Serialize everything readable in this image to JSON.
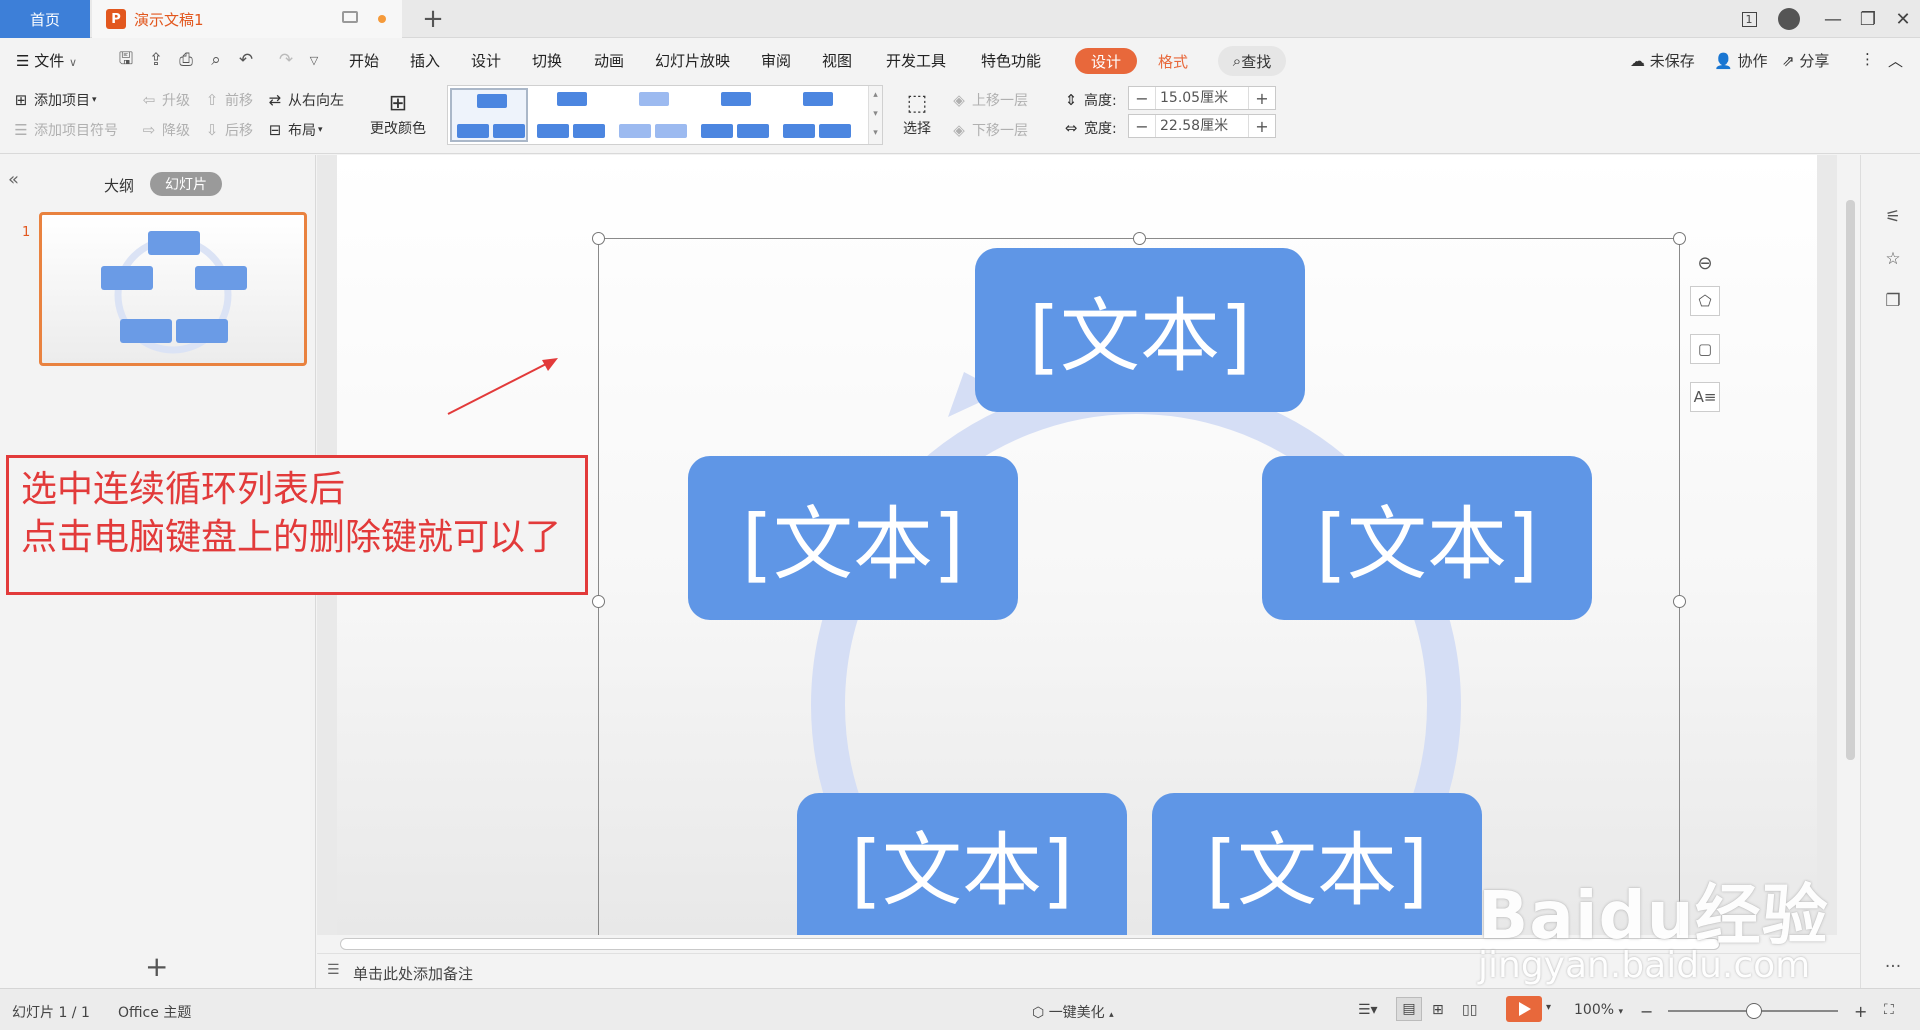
{
  "titlebar": {
    "home_tab": "首页",
    "doc_tab": "演示文稿1",
    "new_tab": "+",
    "window_count": "1"
  },
  "menubar": {
    "file": "文件",
    "tabs": [
      "开始",
      "插入",
      "设计",
      "切换",
      "动画",
      "幻灯片放映",
      "审阅",
      "视图",
      "开发工具",
      "特色功能"
    ],
    "design_active": "设计",
    "format": "格式",
    "search": "查找",
    "unsaved": "未保存",
    "collab": "协作",
    "share": "分享"
  },
  "ribbon": {
    "add_item": "添加项目",
    "add_bullet": "添加项目符号",
    "promote": "升级",
    "demote": "降级",
    "move_up": "前移",
    "move_down": "后移",
    "right_to_left": "从右向左",
    "layout": "布局",
    "change_color": "更改颜色",
    "select": "选择",
    "bring_forward": "上移一层",
    "send_backward": "下移一层",
    "height_label": "高度:",
    "height_value": "15.05厘米",
    "width_label": "宽度:",
    "width_value": "22.58厘米"
  },
  "leftpanel": {
    "outline_tab": "大纲",
    "slides_tab": "幻灯片",
    "slide_number": "1",
    "add_slide": "+"
  },
  "callout": {
    "line1": "选中连续循环列表后",
    "line2": "点击电脑键盘上的删除键就可以了"
  },
  "slide": {
    "box_text": "[文本]"
  },
  "notes": {
    "placeholder": "单击此处添加备注"
  },
  "statusbar": {
    "slide_info": "幻灯片 1 / 1",
    "theme": "Office 主题",
    "beautify": "一键美化",
    "zoom": "100%"
  },
  "watermark": {
    "brand": "Baidu经验",
    "url": "jingyan.baidu.com"
  },
  "colors": {
    "accent": "#e8683b",
    "home_tab": "#3d7fd8",
    "smartart_box": "#5f96e6",
    "callout": "#e23a3a"
  }
}
